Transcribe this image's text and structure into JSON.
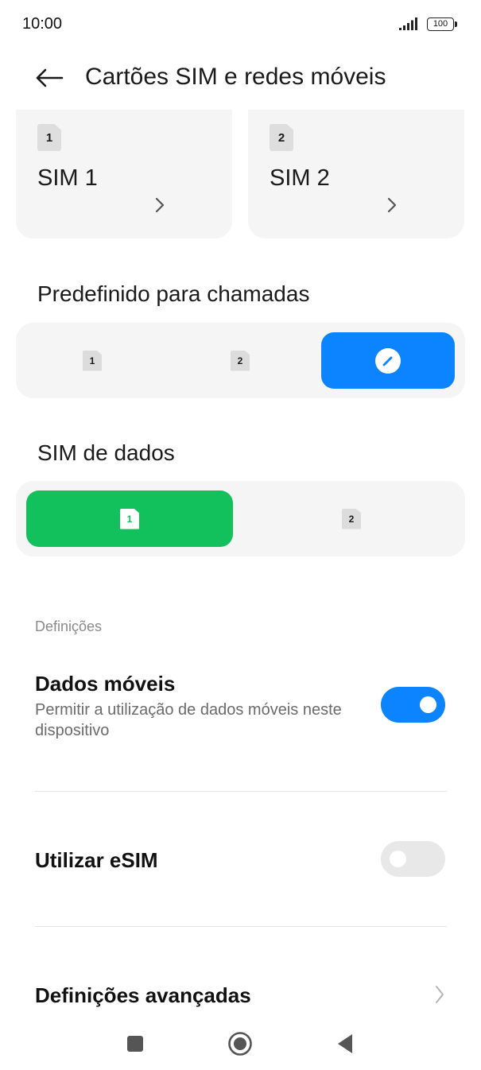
{
  "status_bar": {
    "time": "10:00",
    "battery": "100"
  },
  "header": {
    "title": "Cartões SIM e redes móveis"
  },
  "sim_cards": [
    {
      "badge": "1",
      "name": "SIM 1"
    },
    {
      "badge": "2",
      "name": "SIM 2"
    }
  ],
  "calls_section": {
    "title": "Predefinido para chamadas",
    "options": [
      "1",
      "2"
    ],
    "selected": "edit"
  },
  "data_section": {
    "title": "SIM de dados",
    "options": [
      "1",
      "2"
    ],
    "selected": "1"
  },
  "settings": {
    "group_label": "Definições",
    "mobile_data": {
      "title": "Dados móveis",
      "subtitle": "Permitir a utilização de dados móveis neste dispositivo",
      "enabled": true
    },
    "esim": {
      "title": "Utilizar eSIM",
      "enabled": false
    },
    "advanced": {
      "title": "Definições avançadas"
    }
  },
  "colors": {
    "accent_blue": "#0d84ff",
    "accent_green": "#12c05c",
    "card_bg": "#f5f5f5"
  },
  "nav": {
    "icons": [
      "recents-square-icon",
      "home-circle-icon",
      "back-triangle-icon"
    ]
  }
}
